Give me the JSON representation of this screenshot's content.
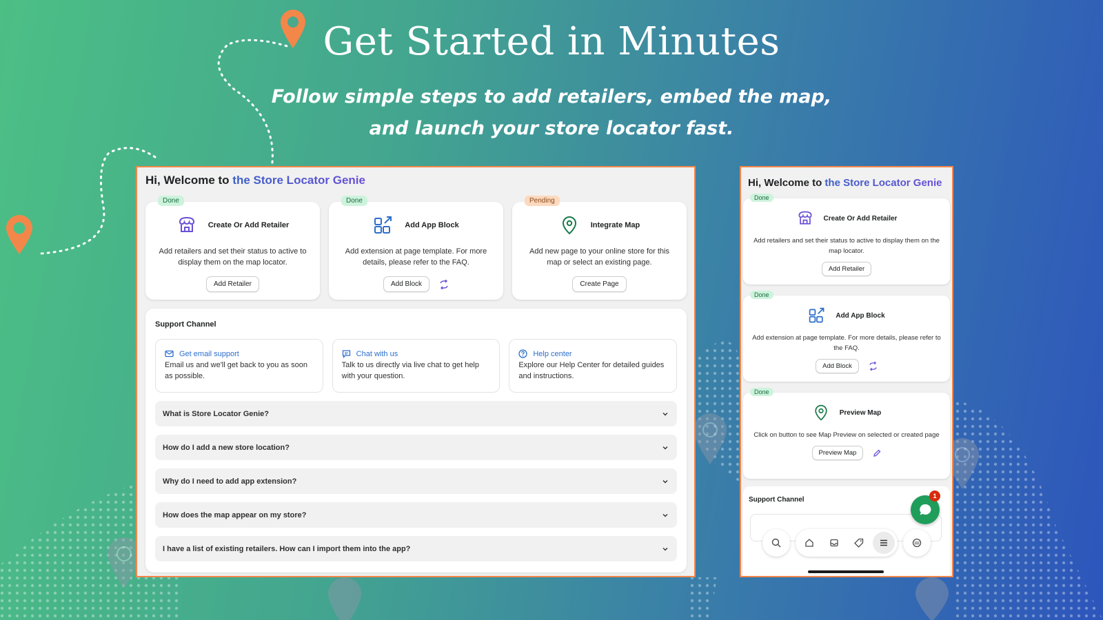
{
  "hero": {
    "title": "Get Started in Minutes",
    "subtitle_line1": "Follow simple steps to add retailers, embed the map,",
    "subtitle_line2": "and launch your store locator fast."
  },
  "welcome": {
    "prefix": "Hi, Welcome to",
    "brand": "the Store Locator Genie"
  },
  "steps": [
    {
      "status": "Done",
      "title": "Create Or Add Retailer",
      "description": "Add retailers and set their status to active to display them on the map locator.",
      "button": "Add Retailer",
      "icon": "store-icon"
    },
    {
      "status": "Done",
      "title": "Add App Block",
      "description": "Add extension at page template. For more details, please refer to the FAQ.",
      "button": "Add Block",
      "icon": "app-block-icon"
    },
    {
      "status": "Pending",
      "title": "Integrate Map",
      "description": "Add new page to your online store for this map or select an existing page.",
      "button": "Create Page",
      "icon": "map-pin-icon"
    }
  ],
  "support": {
    "title": "Support Channel",
    "channels": [
      {
        "title": "Get email support",
        "description": "Email us and we'll get back to you as soon as possible.",
        "icon": "email-icon"
      },
      {
        "title": "Chat with us",
        "description": "Talk to us directly via live chat to get help with your question.",
        "icon": "chat-icon"
      },
      {
        "title": "Help center",
        "description": "Explore our Help Center for detailed guides and instructions.",
        "icon": "help-icon"
      }
    ]
  },
  "faqs": [
    "What is Store Locator Genie?",
    "How do I add a new store location?",
    "Why do I need to add app extension?",
    "How does the map appear on my store?",
    "I have a list of existing retailers. How can I import them into the app?"
  ],
  "mobile": {
    "steps": [
      {
        "status": "Done",
        "title": "Create Or Add Retailer",
        "description": "Add retailers and set their status to active to display them on the map locator.",
        "button": "Add Retailer"
      },
      {
        "status": "Done",
        "title": "Add App Block",
        "description": "Add extension at page template. For more details, please refer to the FAQ.",
        "button": "Add Block"
      },
      {
        "status": "Done",
        "title": "Preview Map",
        "description": "Click on button to see Map Preview on selected or created page",
        "button": "Preview Map"
      }
    ],
    "support_title": "Support Channel",
    "chat_count": "1"
  },
  "colors": {
    "accent_border": "#f3874a",
    "brand_gradient_start": "#3a5fc8",
    "brand_gradient_end": "#6a4fd6",
    "done_badge": "#cdf3dc",
    "pending_badge": "#fcd9bf",
    "link": "#2c6ecb"
  }
}
